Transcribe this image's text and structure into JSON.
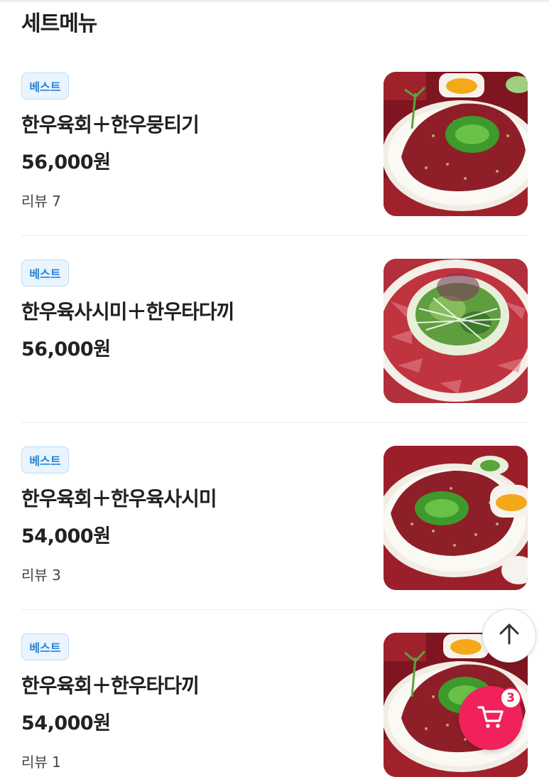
{
  "section": {
    "title": "세트메뉴"
  },
  "items": [
    {
      "badge": "베스트",
      "name": "한우육회＋한우뭉티기",
      "price": "56,000원",
      "review": "리뷰 7",
      "image": "yukhoe-with-egg-yolk"
    },
    {
      "badge": "베스트",
      "name": "한우육사시미＋한우타다끼",
      "price": "56,000원",
      "review": "",
      "image": "sashimi-platter-with-salad"
    },
    {
      "badge": "베스트",
      "name": "한우육회＋한우육사시미",
      "price": "54,000원",
      "review": "리뷰 3",
      "image": "yukhoe-with-egg-yolk"
    },
    {
      "badge": "베스트",
      "name": "한우육회＋한우타다끼",
      "price": "54,000원",
      "review": "리뷰 1",
      "image": "yukhoe-with-egg-yolk"
    }
  ],
  "floating": {
    "scroll_top_icon": "arrow-up-icon",
    "cart_icon": "cart-icon",
    "cart_count": "3"
  },
  "colors": {
    "badge_bg": "#e9f4ff",
    "badge_text": "#2a84d6",
    "cart_button": "#f0215b"
  }
}
